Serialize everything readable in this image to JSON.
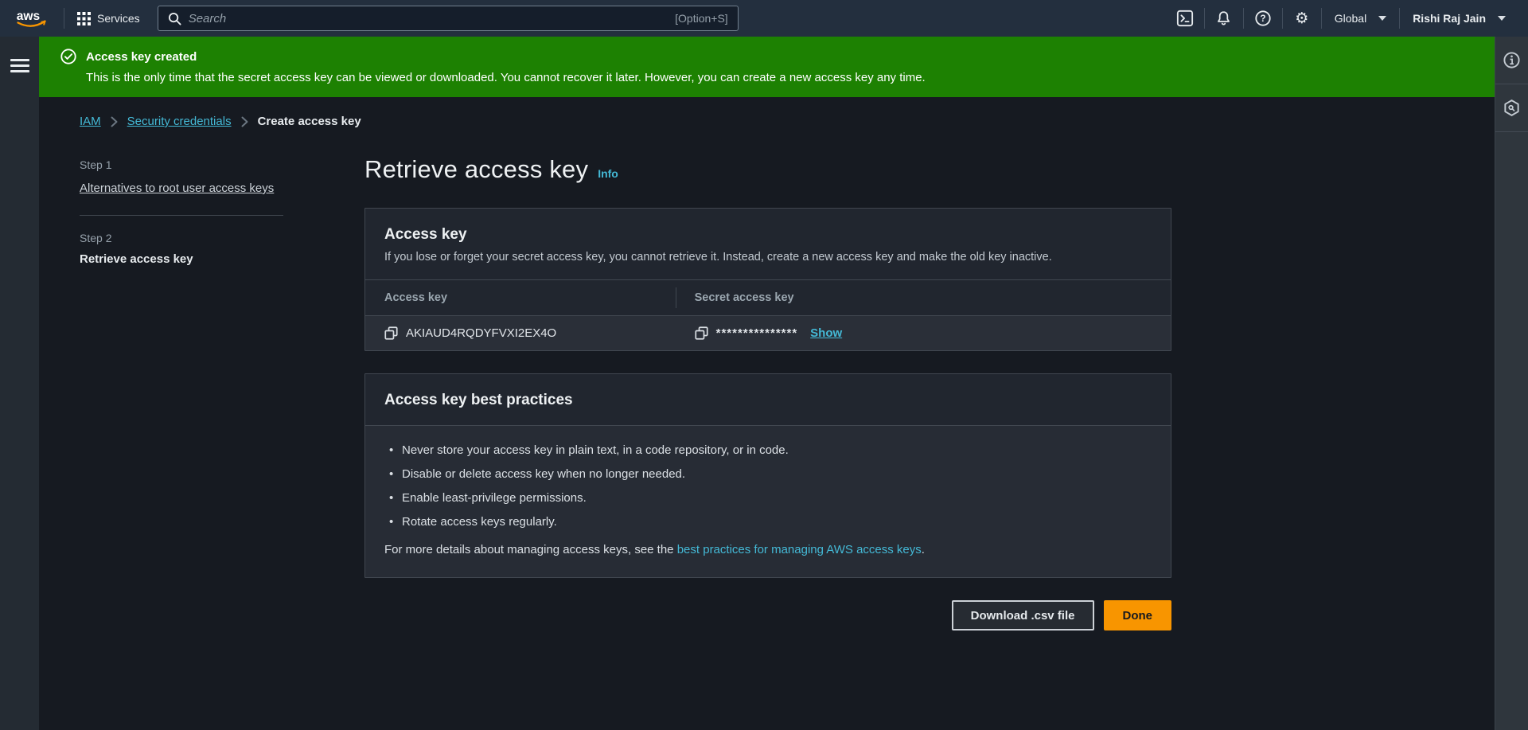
{
  "topnav": {
    "logo_text": "aws",
    "services_label": "Services",
    "search_placeholder": "Search",
    "search_shortcut": "[Option+S]",
    "region_label": "Global",
    "user_label": "Rishi Raj Jain",
    "icons": [
      "cloudshell-icon",
      "bell-icon",
      "help-icon",
      "gear-icon"
    ]
  },
  "banner": {
    "title": "Access key created",
    "message": "This is the only time that the secret access key can be viewed or downloaded. You cannot recover it later. However, you can create a new access key any time.",
    "color": "#1d8102"
  },
  "breadcrumb": {
    "items": [
      "IAM",
      "Security credentials",
      "Create access key"
    ]
  },
  "steps": [
    {
      "step": "Step 1",
      "label": "Alternatives to root user access keys"
    },
    {
      "step": "Step 2",
      "label": "Retrieve access key"
    }
  ],
  "page": {
    "title": "Retrieve access key",
    "info_label": "Info"
  },
  "access_key_card": {
    "title": "Access key",
    "description": "If you lose or forget your secret access key, you cannot retrieve it. Instead, create a new access key and make the old key inactive.",
    "columns": {
      "access_key": "Access key",
      "secret_access_key": "Secret access key"
    },
    "access_key_value": "AKIAUD4RQDYFVXI2EX4O",
    "secret_masked": "***************",
    "show_label": "Show"
  },
  "best_practices_card": {
    "title": "Access key best practices",
    "bullets": [
      "Never store your access key in plain text, in a code repository, or in code.",
      "Disable or delete access key when no longer needed.",
      "Enable least-privilege permissions.",
      "Rotate access keys regularly."
    ],
    "footer_prefix": "For more details about managing access keys, see the ",
    "footer_link": "best practices for managing AWS access keys",
    "footer_suffix": "."
  },
  "actions": {
    "download_label": "Download .csv file",
    "done_label": "Done"
  },
  "colors": {
    "accent_orange": "#f89500",
    "link_teal": "#44b9d6",
    "success_green": "#1d8102",
    "nav_bg": "#232f3e"
  }
}
